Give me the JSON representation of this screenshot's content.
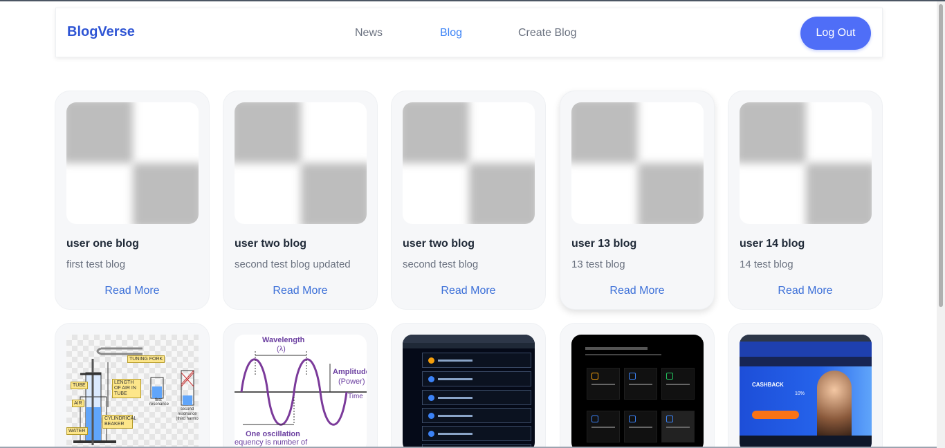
{
  "nav": {
    "brand": "BlogVerse",
    "links": [
      "News",
      "Blog",
      "Create Blog"
    ],
    "active": "Blog",
    "logout_label": "Log Out"
  },
  "cards": [
    {
      "title": "user one blog",
      "subtitle": "first test blog",
      "link": "Read More"
    },
    {
      "title": "user two blog",
      "subtitle": "second test blog updated",
      "link": "Read More"
    },
    {
      "title": "user two blog",
      "subtitle": "second test blog",
      "link": "Read More"
    },
    {
      "title": "user 13 blog",
      "subtitle": "13 test blog",
      "link": "Read More"
    },
    {
      "title": "user 14 blog",
      "subtitle": "14 test blog",
      "link": "Read More"
    }
  ],
  "row2_images": {
    "tuning": {
      "labels": [
        "TUNING FORK",
        "TUBE",
        "LENGTH OF AIR IN TUBE",
        "AIR",
        "CYLINDRICAL BEAKER",
        "WATER",
        "first resonance",
        "second resonance (third harmo"
      ]
    },
    "wave": {
      "wavelength": "Wavelength",
      "lambda": "(λ)",
      "amplitude": "Amplitude",
      "power": "(Power)",
      "time": "Time",
      "oscillation": "One oscillation",
      "frequency": "equency is number of"
    },
    "web_banner": {
      "heading": "CASHBACK",
      "button": "",
      "line1": "10%"
    }
  },
  "colors": {
    "brand": "#2f55d4",
    "active_link": "#3b82f6",
    "button": "#4f6ef7",
    "read_more": "#3b6fd8"
  }
}
